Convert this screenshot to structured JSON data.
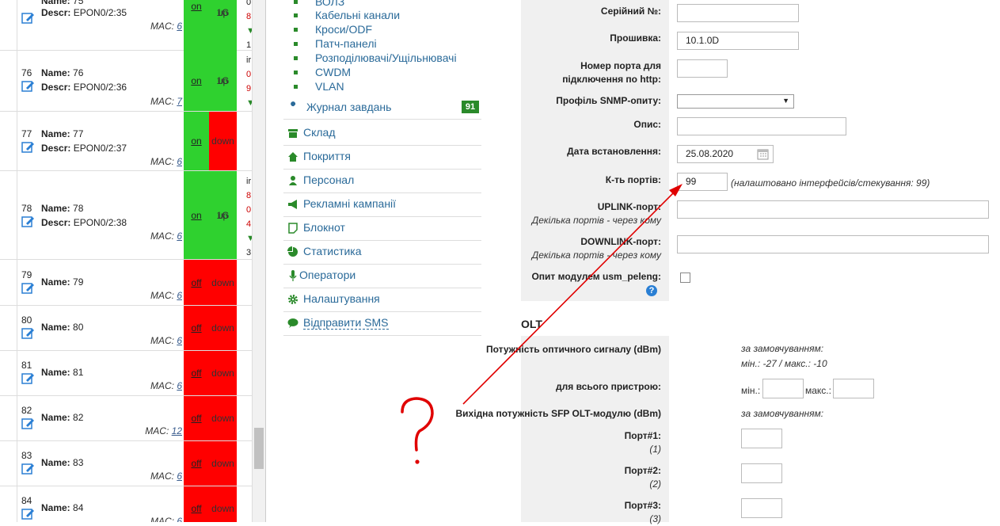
{
  "ports": [
    {
      "num": "",
      "name": "75",
      "descr": "EPON0/2:35",
      "mac": "6",
      "admin": "on",
      "oper": "up",
      "speed": "1G",
      "extra": [
        "0",
        "8",
        "▼",
        "1"
      ]
    },
    {
      "num": "76",
      "name": "76",
      "descr": "EPON0/2:36",
      "mac": "7",
      "admin": "on",
      "oper": "up",
      "speed": "1G",
      "extra": [
        "ir",
        "0",
        "9",
        "▼"
      ]
    },
    {
      "num": "77",
      "name": "77",
      "descr": "EPON0/2:37",
      "mac": "6",
      "admin": "on",
      "oper": "down",
      "speed": ""
    },
    {
      "num": "78",
      "name": "78",
      "descr": "EPON0/2:38",
      "mac": "6",
      "admin": "on",
      "oper": "up",
      "speed": "1G",
      "extra": [
        "ir",
        "8",
        "0",
        "4",
        "▼",
        "3"
      ]
    },
    {
      "num": "79",
      "name": "79",
      "descr": "",
      "mac": "6",
      "admin": "off",
      "oper": "down",
      "speed": ""
    },
    {
      "num": "80",
      "name": "80",
      "descr": "",
      "mac": "6",
      "admin": "off",
      "oper": "down",
      "speed": ""
    },
    {
      "num": "81",
      "name": "81",
      "descr": "",
      "mac": "6",
      "admin": "off",
      "oper": "down",
      "speed": ""
    },
    {
      "num": "82",
      "name": "82",
      "descr": "",
      "mac": "12",
      "admin": "off",
      "oper": "down",
      "speed": ""
    },
    {
      "num": "83",
      "name": "83",
      "descr": "",
      "mac": "6",
      "admin": "off",
      "oper": "down",
      "speed": ""
    },
    {
      "num": "84",
      "name": "84",
      "descr": "",
      "mac": "6",
      "admin": "off",
      "oper": "down",
      "speed": ""
    }
  ],
  "labels": {
    "name": "Name:",
    "descr": "Descr:",
    "mac": "MAC:"
  },
  "submenu": [
    "ВОЛЗ",
    "Кабельні канали",
    "Кроси/ODF",
    "Патч-панелі",
    "Розподілювачі/Ущільнювачі",
    "CWDM",
    "VLAN"
  ],
  "menu": [
    {
      "label": "Журнал завдань",
      "icon": "wrench-icon"
    },
    {
      "label": "Склад",
      "icon": "box-icon"
    },
    {
      "label": "Покриття",
      "icon": "home-icon"
    },
    {
      "label": "Персонал",
      "icon": "user-icon"
    },
    {
      "label": "Рекламні кампанії",
      "icon": "megaphone-icon"
    },
    {
      "label": "Блокнот",
      "icon": "note-icon"
    },
    {
      "label": "Статистика",
      "icon": "chart-icon"
    },
    {
      "label": "Оператори",
      "icon": "microphone-icon"
    },
    {
      "label": "Налаштування",
      "icon": "gear-icon"
    },
    {
      "label": "Відправити SMS",
      "icon": "sms-icon"
    }
  ],
  "tasks_badge": "91",
  "form": {
    "serial_label": "Серійний №:",
    "serial_value": "",
    "firmware_label": "Прошивка:",
    "firmware_value": "10.1.0D",
    "http_port_label": "Номер порта для підключення по http:",
    "http_port_value": "",
    "snmp_label": "Профіль SNMP-опиту:",
    "snmp_value": "",
    "desc_label": "Опис:",
    "desc_value": "",
    "install_date_label": "Дата встановлення:",
    "install_date_value": "25.08.2020",
    "ports_count_label": "К-ть портів:",
    "ports_count_value": "99",
    "ports_count_note": "(налаштовано інтерфейсів/стекування: 99)",
    "uplink_label": "UPLINK-порт:",
    "uplink_hint": "Декілька портів - через кому",
    "downlink_label": "DOWNLINK-порт:",
    "downlink_hint": "Декілька портів - через кому",
    "usm_label": "Опит модулем usm_peleng:"
  },
  "olt": {
    "title": "OLT",
    "optical_power_label": "Потужність оптичного сигналу (dBm)",
    "default_note": "за замовчуванням:",
    "default_range": "мін.: -27 / макс.: -10",
    "whole_device_label": "для всього пристрою:",
    "min_label": "мін.:",
    "max_label": "макс.:",
    "sfp_label": "Вихідна потужність SFP OLT-модулю (dBm)",
    "sfp_note": "за замовчуванням:",
    "port1": "Порт#1:",
    "port1_n": "(1)",
    "port2": "Порт#2:",
    "port2_n": "(2)",
    "port3": "Порт#3:",
    "port3_n": "(3)"
  },
  "annotation": {
    "symbol": "?",
    "color": "#e00000"
  }
}
